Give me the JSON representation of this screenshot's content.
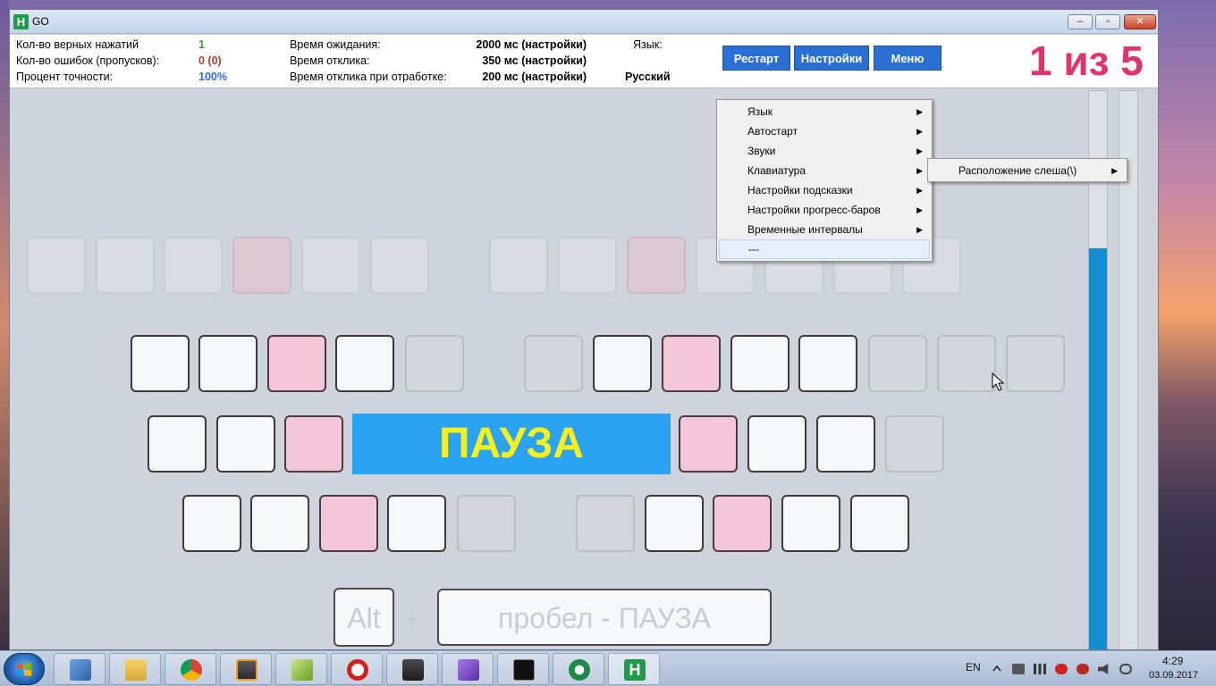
{
  "window": {
    "title": "GO",
    "app_icon": "H",
    "min_glyph": "‒",
    "max_glyph": "▫",
    "close_glyph": "✕"
  },
  "stats": {
    "correct_label": "Кол-во верных нажатий",
    "correct_value": "1",
    "errors_label": "Кол-во ошибок (пропусков):",
    "errors_value": "0 (0)",
    "accuracy_label": "Процент точности:",
    "accuracy_value": "100%",
    "wait_label": "Время ожидания:",
    "wait_value": "2000 мс (настройки)",
    "response_label": "Время отклика:",
    "response_value": "350 мс (настройки)",
    "practice_label": "Время отклика при отработке:",
    "practice_value": "200 мс (настройки)",
    "lang_label": "Язык:",
    "lang_value": "Русский"
  },
  "buttons": {
    "restart": "Рестарт",
    "settings": "Настройки",
    "menu": "Меню"
  },
  "counter": "1 из 5",
  "pause_label": "ПАУЗА",
  "hint": {
    "alt": "Alt",
    "plus": "+",
    "space": "пробел  -  ПАУЗА"
  },
  "progress": {
    "left_bar_fill": 0.72,
    "right_bar_fill": 0.0
  },
  "context_menu": {
    "items": [
      {
        "label": "Язык",
        "arrow": "▶"
      },
      {
        "label": "Автостарт",
        "arrow": "▶"
      },
      {
        "label": "Звуки",
        "arrow": "▶"
      },
      {
        "label": "Клавиатура",
        "arrow": "▶"
      },
      {
        "label": "Настройки подсказки",
        "arrow": "▶"
      },
      {
        "label": "Настройки прогресс-баров",
        "arrow": "▶"
      },
      {
        "label": "Временные интервалы",
        "arrow": "▶"
      },
      {
        "label": "---",
        "arrow": ""
      }
    ],
    "submenu": {
      "label": "Расположение слеша(\\)",
      "arrow": "▶"
    }
  },
  "taskbar": {
    "apps": [
      "file-manager-icon",
      "explorer-icon",
      "chrome-icon",
      "sublime-icon",
      "notepad-icon",
      "opera-icon",
      "media-icon",
      "visual-studio-icon",
      "cmd-icon",
      "hsoft-icon",
      "go-app-icon"
    ],
    "lang": "EN",
    "time": "4:29",
    "date": "03.09.2017"
  },
  "colors": {
    "accent_blue": "#2a6fd4",
    "pause_bg": "#2aa3f3",
    "pause_text": "#f6ef1a",
    "counter": "#e0346a",
    "pink_key": "#f4c6d9",
    "progress": "#138ed1"
  }
}
